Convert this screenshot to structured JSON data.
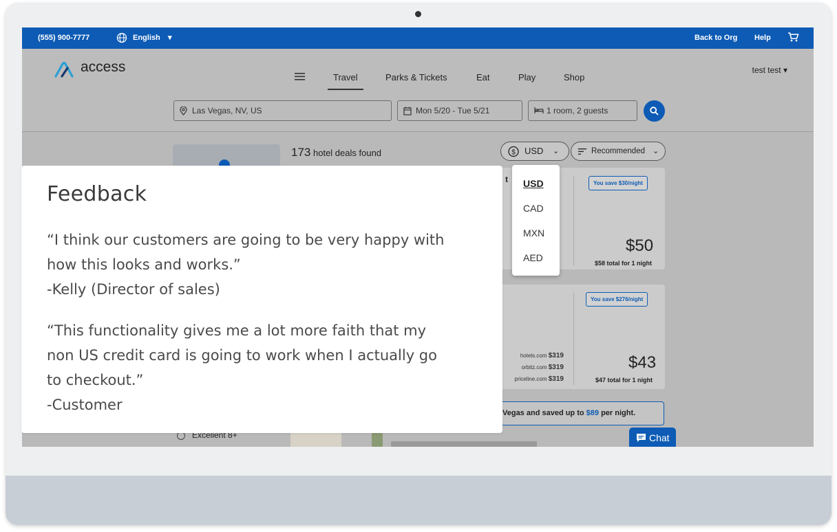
{
  "topbar": {
    "phone": "(555) 900-7777",
    "language": "English",
    "back_to_org": "Back to Org",
    "help": "Help"
  },
  "brand": {
    "name": "access"
  },
  "nav": {
    "links": [
      "Travel",
      "Parks & Tickets",
      "Eat",
      "Play",
      "Shop"
    ],
    "active": "Travel",
    "user": "test test"
  },
  "search": {
    "location": "Las Vegas, NV, US",
    "dates": "Mon 5/20 - Tue 5/21",
    "guests": "1 room, 2 guests"
  },
  "results": {
    "count": "173",
    "count_label": "hotel deals found",
    "currency": "USD",
    "sort": "Recommended"
  },
  "currency_menu": {
    "options": [
      "USD",
      "CAD",
      "MXN",
      "AED"
    ],
    "selected": "USD"
  },
  "cards": [
    {
      "badge": "You save $30/night",
      "price": "$50",
      "total": "$58 total for 1 night",
      "partial_char": "t"
    },
    {
      "badge": "You save $276/night",
      "price": "$43",
      "total": "$47 total for 1 night",
      "partners": [
        {
          "site": "hotels.com",
          "price": "$319"
        },
        {
          "site": "orbitz.com",
          "price": "$319"
        },
        {
          "site": "priceline.com",
          "price": "$319"
        }
      ]
    }
  ],
  "banner": {
    "text_before": "Vegas and saved up to ",
    "amount": "$89",
    "text_after": " per night."
  },
  "filters": {
    "excellent": "Excellent 8+"
  },
  "chat": {
    "label": "Chat"
  },
  "feedback": {
    "title": "Feedback",
    "quote1_line1": "“I think our customers are going to be very happy with",
    "quote1_line2": "how this looks and works.”",
    "quote1_author": "-Kelly (Director of sales)",
    "quote2_line1": "“This functionality gives me a lot more faith that my",
    "quote2_line2": "non US credit card is going to work when I actually go",
    "quote2_line3": "to checkout.”",
    "quote2_author": "-Customer"
  },
  "colors": {
    "brand_blue": "#0d5bb5",
    "monitor_chin": "#c8ced6",
    "overlay_gray": "#b9b9b9"
  }
}
